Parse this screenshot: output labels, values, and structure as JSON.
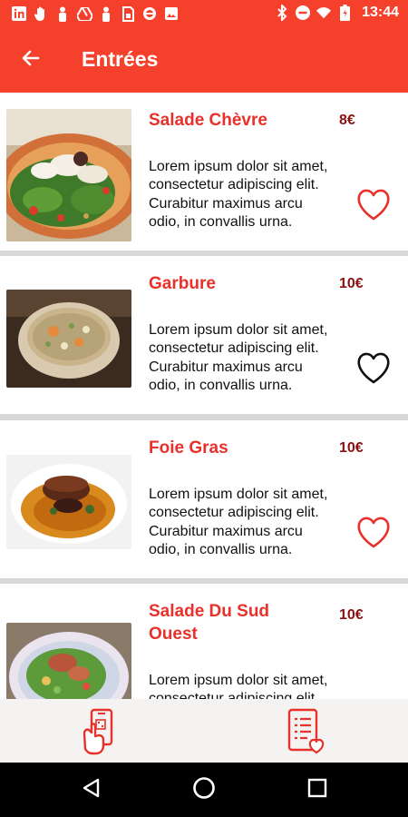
{
  "status_bar": {
    "time": "13:44",
    "left_icons": [
      "linkedin-icon",
      "hand-icon",
      "person-icon",
      "drive-icon",
      "person-icon",
      "sim-icon",
      "circle-icon",
      "image-icon"
    ],
    "right_icons": [
      "bluetooth-icon",
      "do-not-disturb-icon",
      "wifi-icon",
      "battery-icon"
    ]
  },
  "app_bar": {
    "title": "Entrées",
    "back_icon": "arrow-left-icon"
  },
  "dishes": [
    {
      "name": "Salade Chèvre",
      "price": "8€",
      "description": "Lorem ipsum dolor sit amet, consectetur adipiscing elit. Curabitur maximus arcu odio, in convallis urna.",
      "favorite": true
    },
    {
      "name": "Garbure",
      "price": "10€",
      "description": "Lorem ipsum dolor sit amet, consectetur adipiscing elit. Curabitur maximus arcu odio, in convallis urna.",
      "favorite": false
    },
    {
      "name": "Foie Gras",
      "price": "10€",
      "description": "Lorem ipsum dolor sit amet, consectetur adipiscing elit. Curabitur maximus arcu odio, in convallis urna.",
      "favorite": true
    },
    {
      "name": "Salade Du Sud Ouest",
      "price": "10€",
      "description": "Lorem ipsum dolor sit amet, consectetur adipiscing elit. Curabitur maximus arcu odio, in convallis urna.",
      "favorite": false
    }
  ],
  "bottom_bar": {
    "left_icon": "phone-order-icon",
    "right_icon": "favorites-list-icon"
  },
  "nav_bar": {
    "icons": [
      "back-triangle-icon",
      "home-circle-icon",
      "recents-square-icon"
    ]
  },
  "colors": {
    "primary": "#f5402c",
    "dish_name": "#e8312b",
    "price": "#8a1212",
    "favorite_on": "#e8312b",
    "favorite_off": "#111111"
  }
}
